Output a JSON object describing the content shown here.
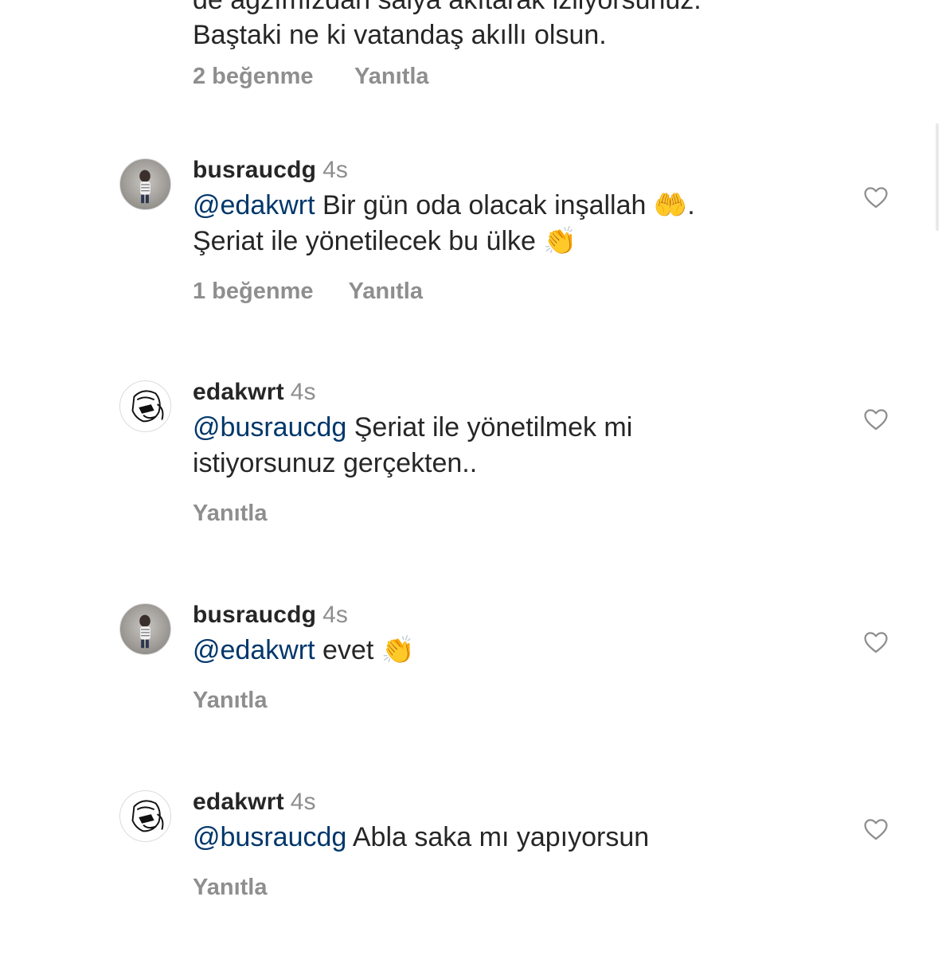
{
  "partial_comment": {
    "line_1_cut": "de ağzımızdan salya akıtarak izliyorsunuz.",
    "line_2": "Baştaki ne ki vatandaş akıllı olsun.",
    "likes": "2 beğenme",
    "reply": "Yanıtla"
  },
  "comments": [
    {
      "username": "busraucdg",
      "time": "4s",
      "mention": "@edakwrt",
      "text_1": " Bir gün oda olacak inşallah ",
      "emoji_1": "🤲",
      "text_2": ".",
      "text_line_2": "Şeriat ile yönetilecek bu ülke ",
      "emoji_2": "👏",
      "likes": "1 beğenme",
      "reply": "Yanıtla",
      "avatar_icon": "profile-photo"
    },
    {
      "username": "edakwrt",
      "time": "4s",
      "mention": "@busraucdg",
      "text_1": " Şeriat ile yönetilmek mi",
      "text_line_2": "istiyorsunuz gerçekten..",
      "reply": "Yanıtla",
      "avatar_icon": "sketch-drawing"
    },
    {
      "username": "busraucdg",
      "time": "4s",
      "mention": "@edakwrt",
      "text_1": " evet ",
      "emoji_1": "👏",
      "reply": "Yanıtla",
      "avatar_icon": "profile-photo"
    },
    {
      "username": "edakwrt",
      "time": "4s",
      "mention": "@busraucdg",
      "text_1": " Abla saka mı yapıyorsun",
      "reply": "Yanıtla",
      "avatar_icon": "sketch-drawing"
    }
  ],
  "icons": {
    "like": "heart-outline-icon"
  },
  "colors": {
    "mention": "#00376b",
    "meta": "#8e8e8e",
    "text": "#262626"
  }
}
